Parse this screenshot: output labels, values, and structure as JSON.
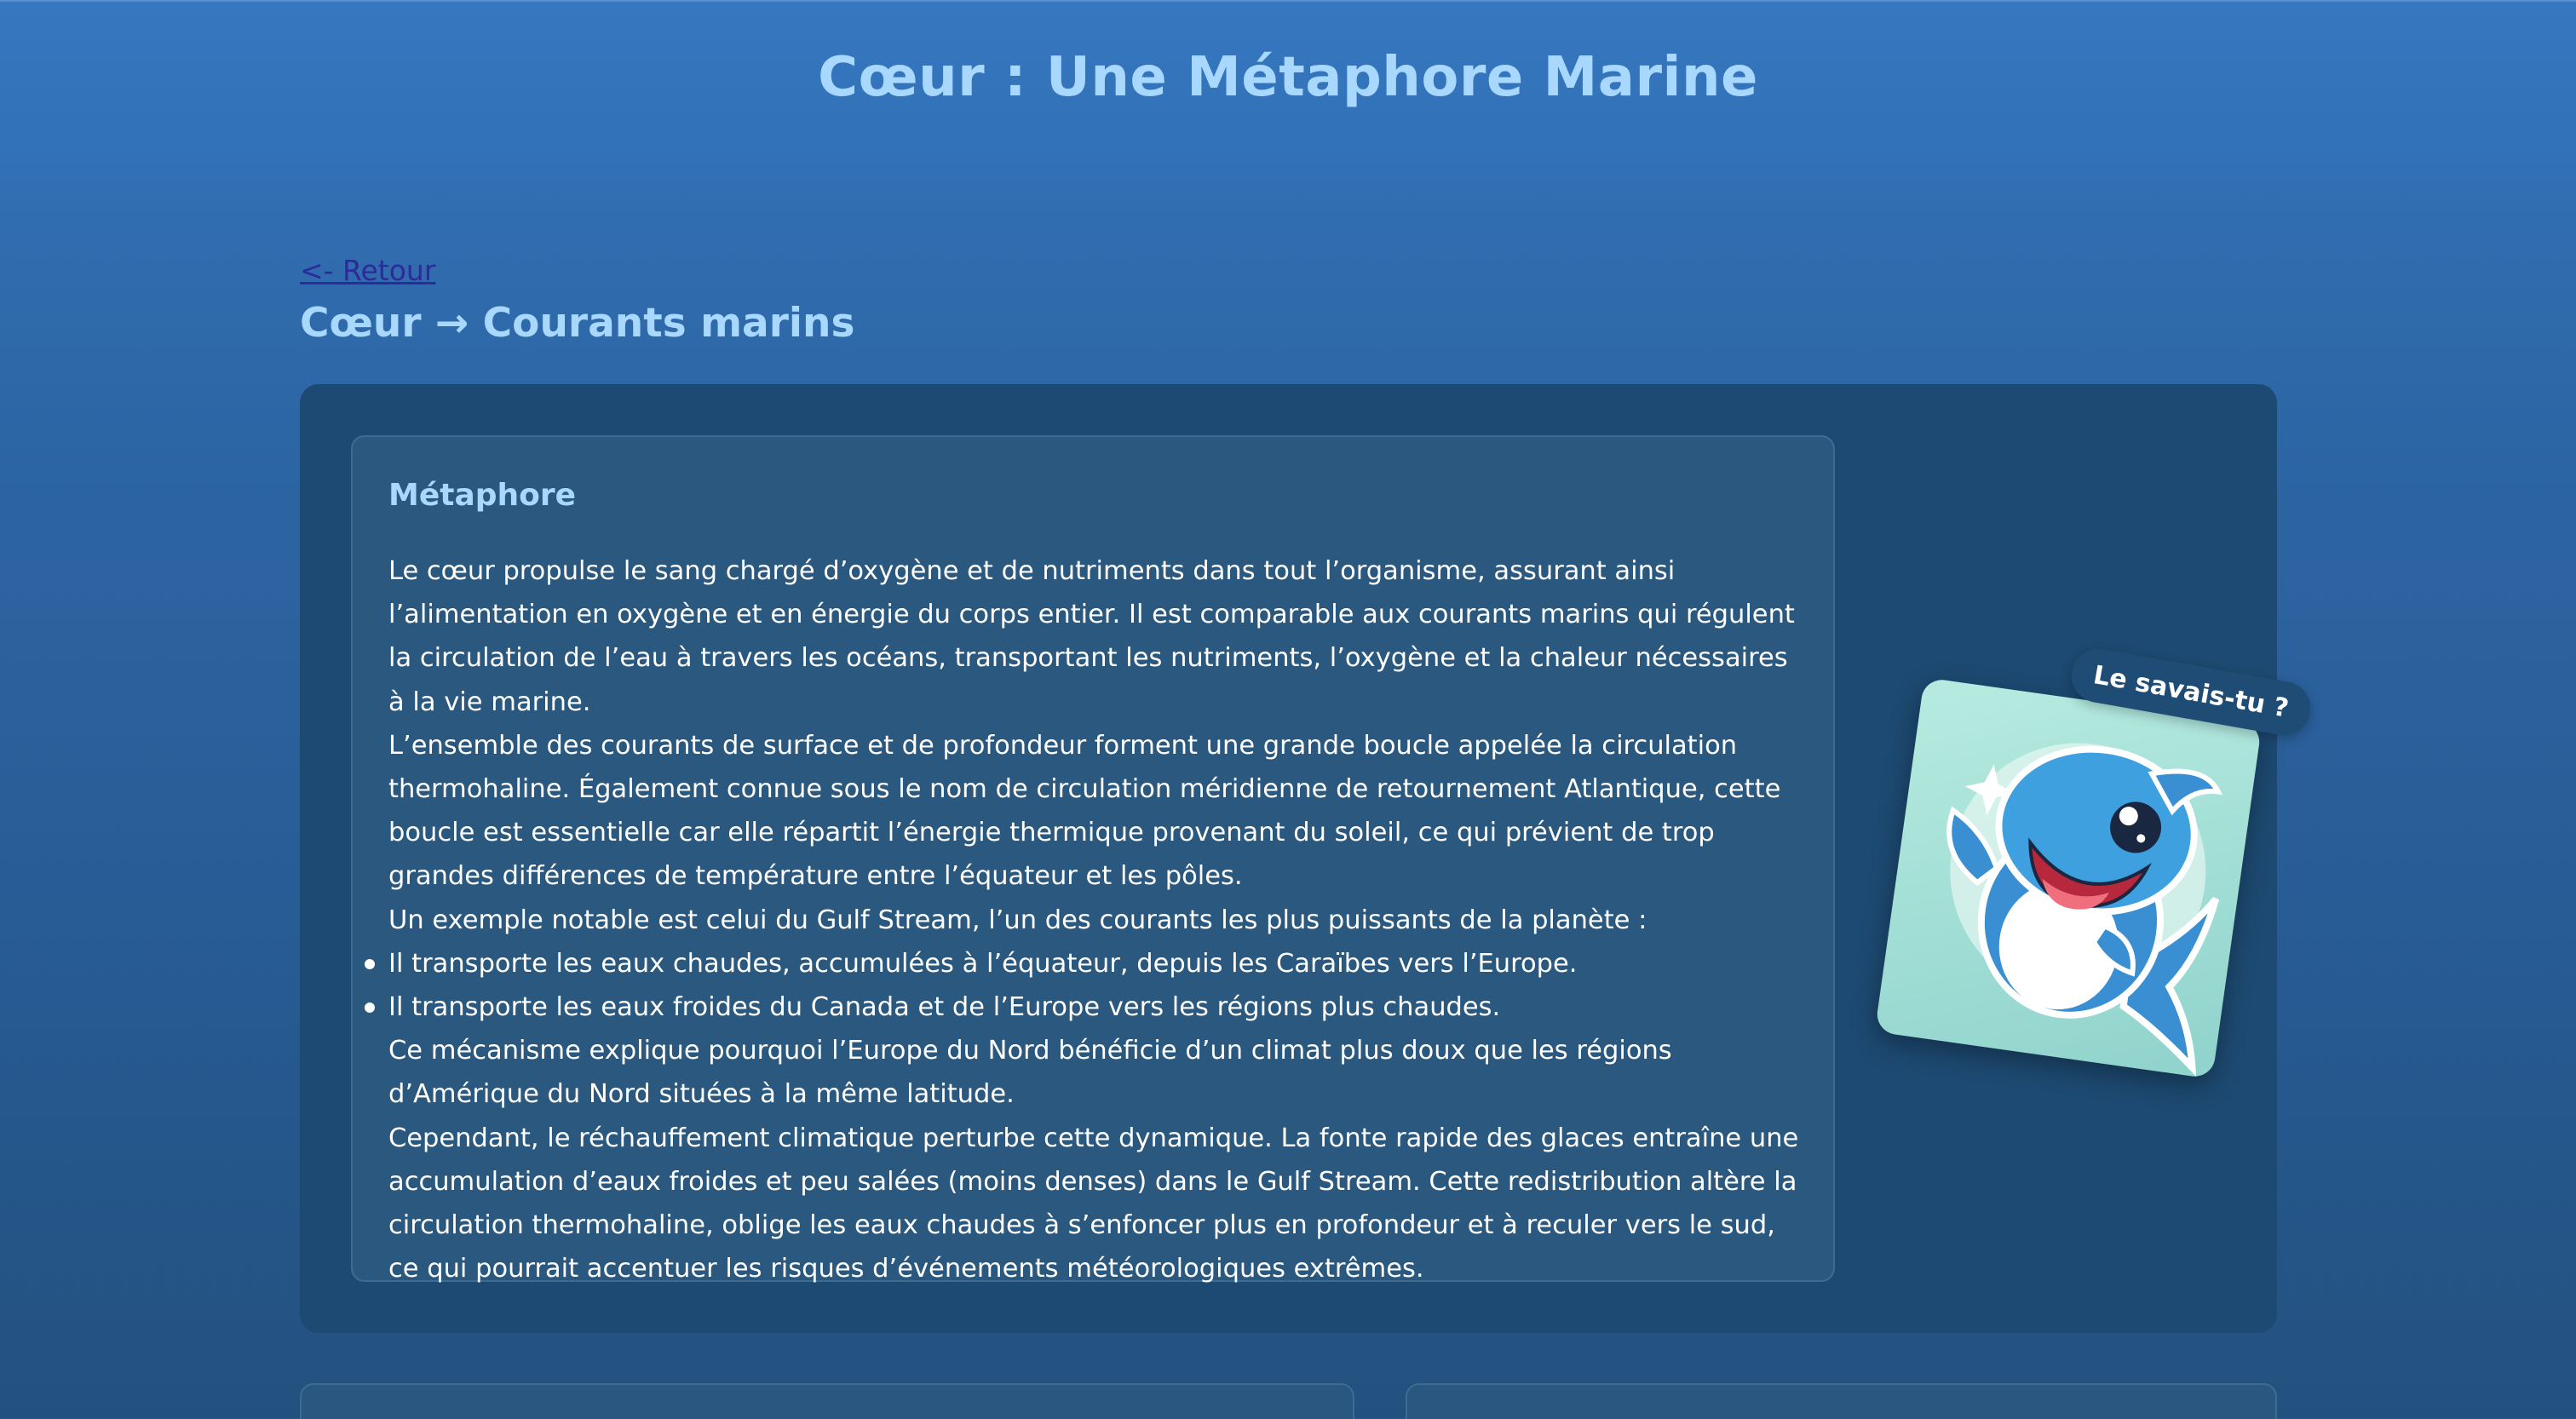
{
  "header": {
    "site_title": "Cœur : Une Métaphore Marine"
  },
  "nav": {
    "back_label": "<- Retour"
  },
  "page": {
    "heading": "Cœur → Courants marins"
  },
  "metaphor": {
    "title": "Métaphore",
    "paragraphs": [
      "Le cœur propulse le sang chargé d’oxygène et de nutriments dans tout l’organisme, assurant ainsi l’alimentation en oxygène et en énergie du corps entier. Il est comparable aux courants marins qui régulent la circulation de l’eau à travers les océans, transportant les nutriments, l’oxygène et la chaleur nécessaires à la vie marine.",
      "L’ensemble des courants de surface et de profondeur forment une grande boucle appelée la circulation thermohaline. Également connue sous le nom de circulation méridienne de retournement Atlantique, cette boucle est essentielle car elle répartit l’énergie thermique provenant du soleil, ce qui prévient de trop grandes différences de température entre l’équateur et les pôles.",
      "Un exemple notable est celui du Gulf Stream, l’un des courants les plus puissants de la planète :"
    ],
    "bullets": [
      "Il transporte les eaux chaudes, accumulées à l’équateur, depuis les Caraïbes vers l’Europe.",
      "Il transporte les eaux froides du Canada et de l’Europe vers les régions plus chaudes."
    ],
    "after_paragraphs": [
      "Ce mécanisme explique pourquoi l’Europe du Nord bénéficie d’un climat plus doux que les régions d’Amérique du Nord situées à la même latitude.",
      "Cependant, le réchauffement climatique perturbe cette dynamique. La fonte rapide des glaces entraîne une accumulation d’eaux froides et peu salées (moins denses) dans le Gulf Stream. Cette redistribution altère la circulation thermohaline, oblige les eaux chaudes à s’enfoncer plus en profondeur et à reculer vers le sud, ce qui pourrait accentuer les risques d’événements météorologiques extrêmes."
    ]
  },
  "sticker": {
    "badge_label": "Le savais-tu ?",
    "icon": "shark-mascot-icon"
  },
  "colors": {
    "title": "#a9d8ff",
    "card_dark": "#1d4a72",
    "card_inner": "#2a587e",
    "link": "#2d2a9a"
  }
}
